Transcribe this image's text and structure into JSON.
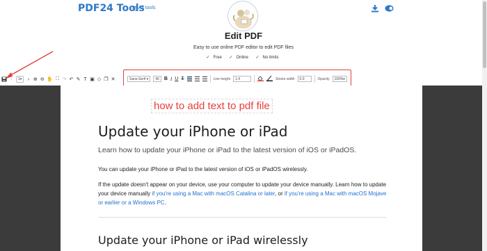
{
  "header": {
    "brand": "PDF24 Tools",
    "all_tools": "All tools",
    "icons": [
      "download-icon",
      "toggle-icon"
    ]
  },
  "hero": {
    "title": "Edit PDF",
    "subtitle": "Easy to use online PDF editor to edit PDF files",
    "features": [
      "Free",
      "Online",
      "No limits"
    ]
  },
  "toolbar": {
    "page_select": "1",
    "font_family": "Sans-Serif",
    "font_size": "40",
    "line_height_label": "Line height",
    "line_height_value": "1.4",
    "stroke_width_label": "Stroke width",
    "stroke_width_value": "0.0",
    "opacity_label": "Opacity",
    "opacity_value": "100%",
    "bold": "B",
    "italic": "I",
    "underline": "U",
    "strike": "T"
  },
  "document": {
    "annotation": "how to add text to pdf file",
    "heading": "Update your iPhone or iPad",
    "lead": "Learn how to update your iPhone or iPad to the latest version of iOS or iPadOS.",
    "para1": "You can update your iPhone or iPad to the latest version of iOS or iPadOS wirelessly.",
    "para2_a": "If the update doesn't appear on your device, use your computer to update your device manually. Learn how to update your device manually ",
    "para2_link1": "if you're using a Mac with macOS Catalina or later",
    "para2_b": ", or ",
    "para2_link2": "if you're using a Mac with macOS Mojave or earlier or a Windows PC",
    "para2_c": ".",
    "heading2": "Update your iPhone or iPad wirelessly"
  },
  "colors": {
    "brand": "#2f79c6",
    "highlight": "#e0403a",
    "link": "#1f6fd0"
  }
}
